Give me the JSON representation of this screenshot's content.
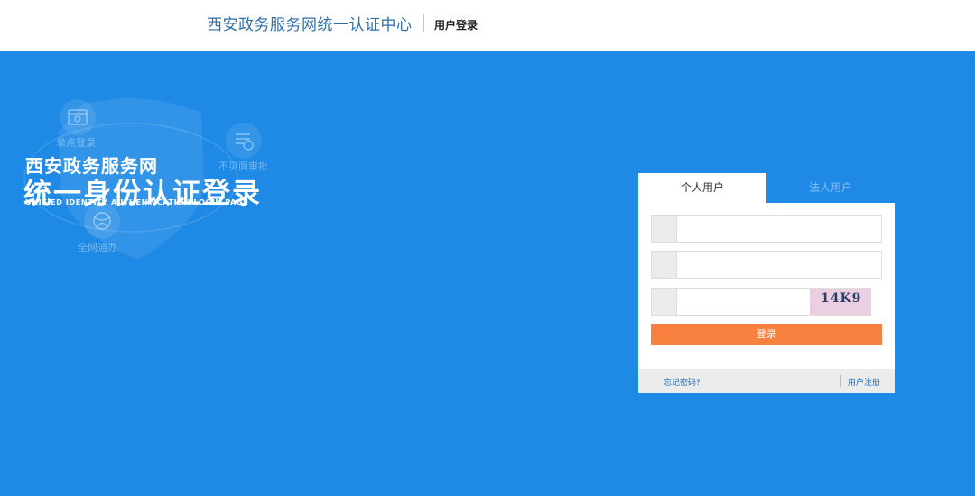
{
  "header": {
    "site_title": "西安政务服务网统一认证中心",
    "page_subtitle": "用户登录"
  },
  "hero": {
    "line1": "西安政务服务网",
    "line2": "统一身份认证登录",
    "line3": "UNIFIED IDENTITY AUTHENTICATION LOGIN PAGE",
    "features": [
      {
        "label": "单点登录",
        "icon": "browser-icon"
      },
      {
        "label": "不见面审批",
        "icon": "checklist-icon"
      },
      {
        "label": "全网通办",
        "icon": "network-icon"
      }
    ]
  },
  "login": {
    "tabs": [
      {
        "label": "个人用户",
        "active": true
      },
      {
        "label": "法人用户",
        "active": false
      }
    ],
    "username": {
      "value": "",
      "placeholder": "",
      "icon": "user-icon"
    },
    "password": {
      "value": "",
      "placeholder": "",
      "icon": "lock-icon"
    },
    "captcha": {
      "value": "",
      "placeholder": "",
      "icon": "shield-icon",
      "code": "14K9"
    },
    "submit_label": "登录",
    "forgot_label": "忘记密码?",
    "register_label": "用户注册"
  },
  "colors": {
    "background": "#1e8ae6",
    "header_title": "#2f6fa8",
    "primary_button": "#f8813f",
    "link": "#1e6fb8"
  }
}
